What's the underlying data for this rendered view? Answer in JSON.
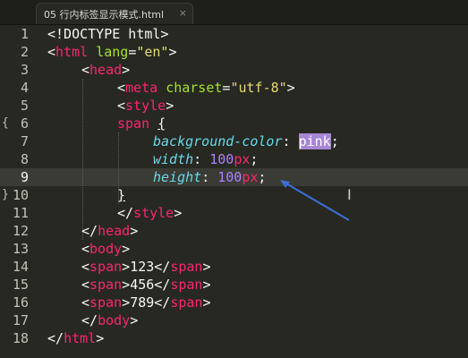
{
  "tab": {
    "title": "05 行内标签显示模式.html",
    "close": "×"
  },
  "gutter": {
    "lines": [
      "1",
      "2",
      "3",
      "4",
      "5",
      "6",
      "7",
      "8",
      "9",
      "10",
      "11",
      "12",
      "13",
      "14",
      "15",
      "16",
      "17",
      "18"
    ],
    "fold_open": "{",
    "fold_close": "}"
  },
  "code": {
    "l1": [
      "<!DOCTYPE html>"
    ],
    "l2": [
      "<",
      "html",
      " ",
      "lang",
      "=",
      "\"en\"",
      ">"
    ],
    "l3": [
      "<",
      "head",
      ">"
    ],
    "l4": [
      "<",
      "meta",
      " ",
      "charset",
      "=",
      "\"utf-8\"",
      ">"
    ],
    "l5": [
      "<",
      "style",
      ">"
    ],
    "l6": [
      "span",
      " ",
      "{"
    ],
    "l7": [
      "background-color",
      ": ",
      "pink",
      ";"
    ],
    "l8": [
      "width",
      ": ",
      "100",
      "px",
      ";"
    ],
    "l9": [
      "height",
      ": ",
      "100",
      "px",
      ";"
    ],
    "l10": [
      "}"
    ],
    "l11": [
      "</",
      "style",
      ">"
    ],
    "l12": [
      "</",
      "head",
      ">"
    ],
    "l13": [
      "<",
      "body",
      ">"
    ],
    "l14": [
      "<",
      "span",
      ">",
      "123",
      "</",
      "span",
      ">"
    ],
    "l15": [
      "<",
      "span",
      ">",
      "456",
      "</",
      "span",
      ">"
    ],
    "l16": [
      "<",
      "span",
      ">",
      "789",
      "</",
      "span",
      ">"
    ],
    "l17": [
      "</",
      "body",
      ">"
    ],
    "l18": [
      "</",
      "html",
      ">"
    ]
  },
  "icons": {
    "cursor": "I-beam-cursor-icon",
    "arrow": "arrow-annotation-icon"
  },
  "colors": {
    "background": "#272822",
    "tag": "#f92672",
    "attr": "#a6e22e",
    "string": "#e6db74",
    "property": "#66d9ef",
    "number": "#ae81ff",
    "selection": "#a786d6",
    "arrow": "#3b6fd8"
  }
}
